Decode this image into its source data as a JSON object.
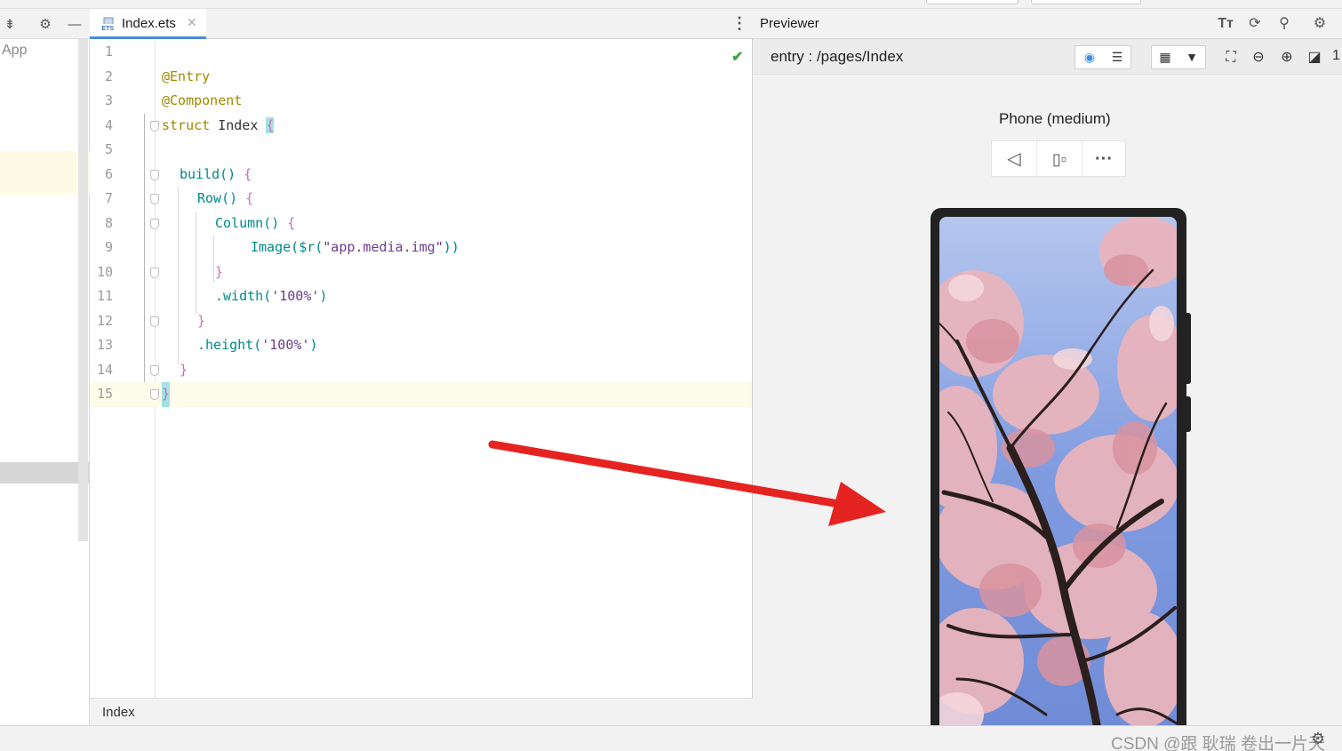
{
  "project_panel": {
    "module_label": "App"
  },
  "editor": {
    "tab_label": "Index.ets",
    "tab_icon": "ets-file-icon",
    "breadcrumb": "Index",
    "lines": [
      {
        "num": "1",
        "indent": 0
      },
      {
        "num": "2",
        "indent": 0
      },
      {
        "num": "3",
        "indent": 0
      },
      {
        "num": "4",
        "indent": 0
      },
      {
        "num": "5",
        "indent": 0
      },
      {
        "num": "6",
        "indent": 2
      },
      {
        "num": "7",
        "indent": 4
      },
      {
        "num": "8",
        "indent": 6
      },
      {
        "num": "9",
        "indent": 10
      },
      {
        "num": "10",
        "indent": 6
      },
      {
        "num": "11",
        "indent": 6
      },
      {
        "num": "12",
        "indent": 4
      },
      {
        "num": "13",
        "indent": 4
      },
      {
        "num": "14",
        "indent": 2
      },
      {
        "num": "15",
        "indent": 0
      }
    ],
    "code": {
      "l2": "@Entry",
      "l3": "@Component",
      "l4_kw": "struct",
      "l4_id": " Index ",
      "l4_br": "{",
      "l6_fn": "build",
      "l6_rest": "() ",
      "l6_br": "{",
      "l7_fn": "Row",
      "l7_rest": "() ",
      "l7_br": "{",
      "l8_fn": "Column",
      "l8_rest": "() ",
      "l8_br": "{",
      "l9_fn": "Image",
      "l9_p1": "(",
      "l9_fn2": "$r",
      "l9_p2": "(",
      "l9_str": "\"app.media.img\"",
      "l9_p3": "))",
      "l10_br": "}",
      "l11_fn": ".width",
      "l11_p1": "(",
      "l11_str": "'100%'",
      "l11_p2": ")",
      "l12_br": "}",
      "l13_fn": ".height",
      "l13_p1": "(",
      "l13_str": "'100%'",
      "l13_p2": ")",
      "l14_br": "}",
      "l15_br": "}"
    },
    "status_icon": "check-icon"
  },
  "previewer": {
    "title": "Previewer",
    "path": "entry : /pages/Index",
    "device_name": "Phone (medium)",
    "zoom_partial": "1",
    "icons": {
      "font": "font-size-icon",
      "refresh": "refresh-icon",
      "plugin": "plugin-icon",
      "settings": "gear-icon"
    }
  },
  "statusbar": {
    "watermark": "CSDN @跟 耿瑞 卷出一片天"
  },
  "colors": {
    "accent": "#4a8ad8",
    "arrow": "#e52321",
    "annotation": "#9d8a00",
    "function": "#00898a",
    "bracket": "#d068b8",
    "string": "#6b3b8c",
    "check": "#3ba64a"
  }
}
